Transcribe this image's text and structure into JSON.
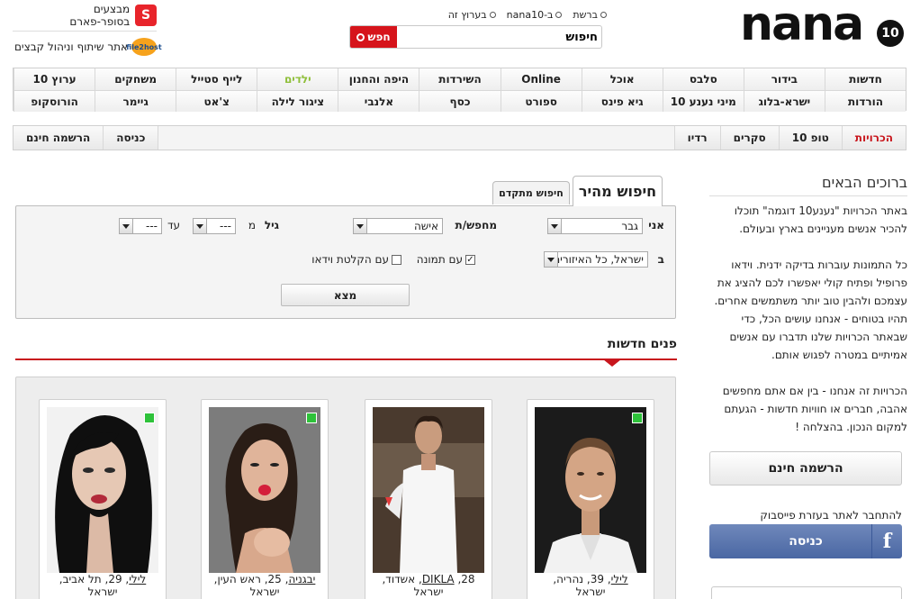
{
  "header": {
    "logo_text": "nana",
    "logo_badge": "10",
    "radios": [
      "ברשת",
      "ב-nana10",
      "בערוץ זה"
    ],
    "search_value": "חיפוש",
    "search_button": "חפש",
    "supersite_label": "מבצעים בסופר-פארם",
    "supersite_logo": "S",
    "filehost_label": "אתר שיתוף וניהול קבצים",
    "filehost_logo": "file2host"
  },
  "nav": {
    "row1": [
      "חדשות",
      "בידור",
      "סלבס",
      "אוכל",
      "Online",
      "השירדות",
      "היפה והחנון",
      "ילדים",
      "לייף סטייל",
      "משחקים",
      "ערוץ 10"
    ],
    "row2": [
      "הורדות",
      "ישרא-בלוג",
      "מיני נענע 10",
      "גיא פינס",
      "ספורט",
      "כסף",
      "אלנבי",
      "ציגור לילה",
      "צ'אט",
      "גיימר",
      "הורוסקופ"
    ]
  },
  "subnav": {
    "right": [
      "הכרויות",
      "טופ 10",
      "סקרים",
      "רדיו"
    ],
    "left": [
      "כניסה",
      "הרשמה חינם"
    ]
  },
  "welcome": {
    "title": "ברוכים הבאים",
    "p1": "באתר הכרויות \"נענע10 דוגמה\" תוכלו להכיר אנשים מעניינים בארץ ובעולם.",
    "p2": "כל התמונות עוברות בדיקה ידנית. וידאו פרופיל ופתיח קולי יאפשרו לכם להציג את עצמכם ולהבין טוב יותר משתמשים אחרים. תהיו בטוחים - אנחנו עושים הכל, כדי שבאתר הכרויות שלנו תדברו עם אנשים אמיתיים במטרה לפגוש אותם.",
    "p3": "הכרויות זה אנחנו - בין אם אתם מחפשים אהבה, חברים או חוויות חדשות - הגעתם למקום הנכון. בהצלחה !",
    "register_button": "הרשמה חינם",
    "facebook_text": "להתחבר לאתר בעזרת פייסבוק",
    "facebook_button": "כניסה",
    "facebook_icon": "f"
  },
  "search": {
    "tab_quick": "חיפוש מהיר",
    "tab_advanced": "חיפוש מתקדם",
    "i_am_label": "אני",
    "i_am_value": "גבר",
    "seeking_label": "מחפש/ת",
    "seeking_value": "אישה",
    "age_label": "גיל",
    "from_label": "מ",
    "from_value": "---",
    "to_label": "עד",
    "to_value": "---",
    "in_label": "ב",
    "region_value": "ישראל, כל האיזורים",
    "with_photo": "עם תמונה",
    "with_video": "עם הקלטת וידאו",
    "find_button": "מצא"
  },
  "faces": {
    "title": "פנים חדשות",
    "cards": [
      {
        "name": "לילי",
        "age": "39",
        "city": "נהריה",
        "country": "ישראל",
        "online": true
      },
      {
        "name": "DIKLA",
        "age": "28",
        "city": "אשדוד",
        "country": "ישראל",
        "online": false
      },
      {
        "name": "יבגניה",
        "age": "25",
        "city": "ראש העין",
        "country": "ישראל",
        "online": true
      },
      {
        "name": "לילי",
        "age": "29",
        "city": "תל אביב",
        "country": "ישראל",
        "online": true
      }
    ]
  }
}
